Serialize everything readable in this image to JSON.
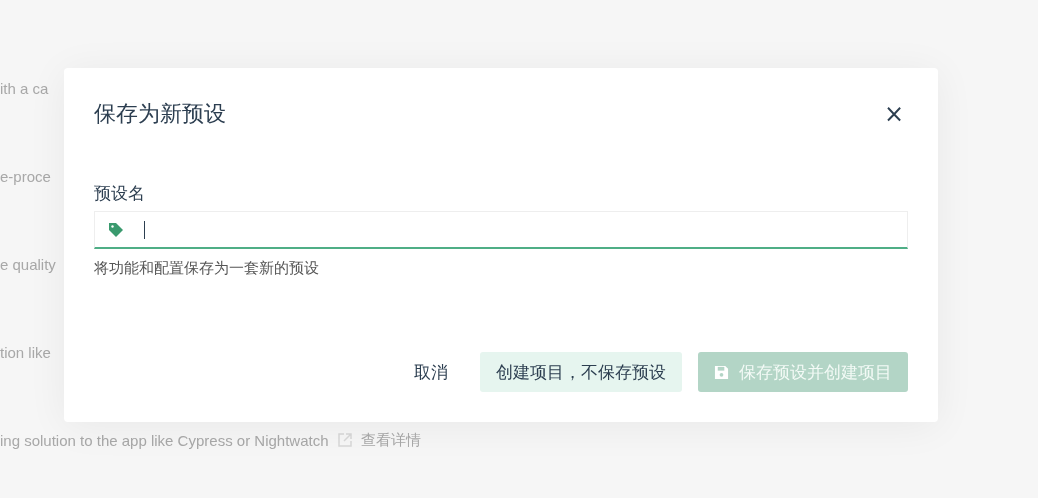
{
  "background_lines": [
    {
      "text": "ith a ca"
    },
    {
      "text": "e-proce"
    },
    {
      "text": "e quality"
    },
    {
      "text": "tion like"
    },
    {
      "text": "ing solution to the app like Cypress or Nightwatch",
      "link": "查看详情"
    }
  ],
  "dialog": {
    "title": "保存为新预设",
    "close": "×",
    "field": {
      "label": "预设名",
      "focused": true,
      "hint": "将功能和配置保存为一套新的预设"
    },
    "buttons": [
      {
        "kind": "text",
        "label": "取消"
      },
      {
        "kind": "secondary",
        "label": "创建项目，不保存预设"
      },
      {
        "kind": "primary",
        "label": "保存预设并创建项目",
        "disabled": true
      }
    ]
  }
}
